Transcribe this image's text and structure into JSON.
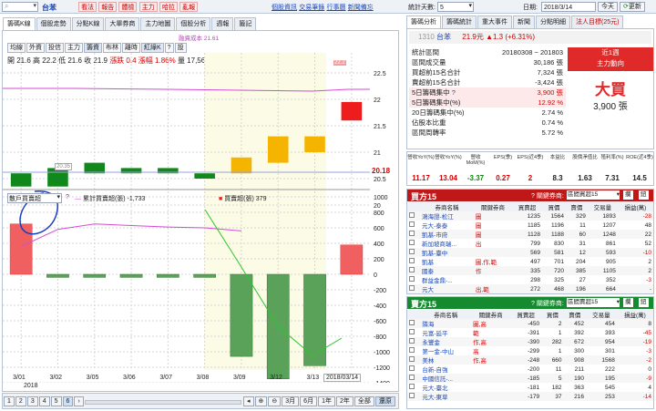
{
  "topbar": {
    "buttons": [
      "看法",
      "報告",
      "體檢",
      "主力",
      "哈拉",
      "亂報"
    ],
    "stock_name": "台苯",
    "links": [
      "個股資訊",
      "交易筆錄",
      "行事曆",
      "新聞備忘"
    ],
    "right_links": [
      "個股資訊",
      "交易筆錄",
      "行事曆",
      "到價通知"
    ],
    "days_label": "統計天數:",
    "days_value": "5",
    "date_label": "日期:",
    "date_value": "2018/3/14",
    "today_btn": "今天",
    "refresh_btn": "更新"
  },
  "left_tabs": [
    "籌碼K線",
    "個股走勢",
    "分點K線",
    "大單券商",
    "主力地圖",
    "個股分析",
    "週報",
    "籤記"
  ],
  "chips": [
    "均線",
    "外資",
    "投信",
    "主力",
    "籌資",
    "布林",
    "離時",
    "紅綠K",
    "設"
  ],
  "legend_top": "融資成本 21.61",
  "ohlc": {
    "open_l": "開",
    "open": "21.6",
    "high_l": "高",
    "high": "22.2",
    "low_l": "低",
    "low": "21.6",
    "close_l": "收",
    "close": "21.9",
    "chg_l": "漲跌",
    "chg": "0.4",
    "pct_l": "漲幅",
    "pct": "1.86%",
    "vol_l": "量",
    "vol": "17,560"
  },
  "price_axis": [
    "22.5",
    "22",
    "21.5",
    "21",
    "20.5",
    "20"
  ],
  "price_marker": "20.18",
  "box_label_high": "22.2",
  "box_label_low": "20.35",
  "lower_select": "散戶買賣超",
  "lower_legend1": "累計買賣超(張) -1,733",
  "lower_legend2": "買賣超(張) 379",
  "lower_axis": [
    "1000",
    "800",
    "600",
    "400",
    "200",
    "0",
    "-200",
    "-400",
    "-600",
    "-800",
    "-1000",
    "-1200",
    "-1400",
    "-1600"
  ],
  "x_labels": [
    "3/01",
    "3/02",
    "3/05",
    "3/06",
    "3/07",
    "3/08",
    "3/09",
    "3/12",
    "3/13"
  ],
  "x_year": "2018",
  "x_current": "2018/03/14",
  "bottom": {
    "pages": [
      "1",
      "2",
      "3",
      "4",
      "5",
      "6"
    ],
    "ranges": [
      "3月",
      "6月",
      "1年",
      "2年",
      "全部",
      "還原"
    ]
  },
  "chart_data": {
    "type": "candlestick",
    "categories": [
      "3/01",
      "3/02",
      "3/05",
      "3/06",
      "3/07",
      "3/08",
      "3/09",
      "3/12",
      "3/13",
      "3/14"
    ],
    "candles": [
      {
        "o": 20.6,
        "c": 20.35,
        "color": "green"
      },
      {
        "o": 20.7,
        "c": 20.35,
        "color": "green"
      },
      {
        "o": 20.8,
        "c": 20.6,
        "color": "green"
      },
      {
        "o": 20.7,
        "c": 20.6,
        "color": "green"
      },
      {
        "o": 20.7,
        "c": 20.6,
        "color": "green"
      },
      {
        "o": 20.5,
        "c": 20.6,
        "color": "green"
      },
      {
        "o": 20.6,
        "c": 20.9,
        "color": "orange"
      },
      {
        "o": 20.8,
        "c": 21.3,
        "color": "orange"
      },
      {
        "o": 21.3,
        "c": 21.0,
        "color": "orange"
      },
      {
        "o": 21.6,
        "c": 21.95,
        "color": "red"
      }
    ],
    "bars": [
      650,
      -40,
      -40,
      -40,
      -40,
      -40,
      -1060,
      -1350,
      -1180,
      379
    ],
    "cum": [
      360,
      580,
      650,
      630,
      610,
      600,
      560,
      -1280,
      -1420,
      -1733
    ]
  },
  "right_tabs": [
    "籌碼分析",
    "籌碼統計",
    "重大事件",
    "新聞",
    "分點明細",
    "法人目標(25元)"
  ],
  "quote": {
    "code": "1310",
    "name": "台苯",
    "price": "21.9元",
    "chg": "▲1.3 (+6.31%)"
  },
  "stats": [
    {
      "k": "統計區間",
      "v": "20180308 ~ 201803"
    },
    {
      "k": "區間成交量",
      "v": "30,186 張"
    },
    {
      "k": "買超前15名合計",
      "v": "7,324 張"
    },
    {
      "k": "賣超前15名合計",
      "v": "-3,424 張"
    },
    {
      "k": "5日籌碼集中",
      "v": "3,900 張"
    },
    {
      "k": "5日籌碼集中(%)",
      "v": "12.92 %"
    },
    {
      "k": "20日籌碼集中(%)",
      "v": "2.74 %"
    },
    {
      "k": "佔股本比重",
      "v": "0.74 %"
    },
    {
      "k": "區間周轉率",
      "v": "5.72 %"
    }
  ],
  "signal": {
    "title": "近1週",
    "sub": "主力動向",
    "big": "大買",
    "amt": "3,900 張"
  },
  "metrics_head": [
    "營收YoY(%)",
    "營收YoY(%)",
    "營收MoM(%)",
    "EPS(季)",
    "EPS(近4季)",
    "本益比",
    "股價淨值比",
    "殖利率(%)",
    "ROE(近4季)"
  ],
  "metrics_val": [
    "11.17",
    "13.04",
    "-3.37",
    "0.27",
    "2",
    "8.3",
    "1.63",
    "7.31",
    "14.5"
  ],
  "buy": {
    "title": "買方15",
    "hint": "關鍵券商:",
    "select": "區間買超15",
    "btn1": "攔",
    "btn2": "鈕",
    "head": [
      "券商名稱",
      "關鍵券商",
      "買賣超",
      "買價",
      "賣價",
      "交易量",
      "損益(萬)"
    ],
    "rows": [
      [
        "鴻海證-松江",
        "圖",
        "1235",
        "1564",
        "329",
        "1893",
        "-28"
      ],
      [
        "元大-泰泰",
        "圖",
        "1185",
        "1196",
        "11",
        "1207",
        "48"
      ],
      [
        "凱基-市府",
        "圖",
        "1128",
        "1188",
        "60",
        "1248",
        "22"
      ],
      [
        "新加坡商瑞...",
        "出",
        "799",
        "830",
        "31",
        "861",
        "52"
      ],
      [
        "凱基-臺中",
        "",
        "569",
        "581",
        "12",
        "593",
        "-10"
      ],
      [
        "凱基",
        "圖,作,範",
        "497",
        "701",
        "204",
        "905",
        "2"
      ],
      [
        "國泰",
        "作",
        "335",
        "720",
        "385",
        "1105",
        "2"
      ],
      [
        "群益金鼎-...",
        "",
        "298",
        "325",
        "27",
        "352",
        "-3"
      ],
      [
        "元大",
        "出,範",
        "272",
        "468",
        "196",
        "664",
        "-"
      ]
    ]
  },
  "sell": {
    "title": "賣方15",
    "hint": "關鍵券商:",
    "select": "區間賣超15",
    "btn1": "攔",
    "btn2": "鈕",
    "head": [
      "券商名稱",
      "關鍵券商",
      "買賣超",
      "買價",
      "賣價",
      "交易量",
      "損益(萬)"
    ],
    "rows": [
      [
        "隣海",
        "圖,高",
        "-450",
        "2",
        "452",
        "454",
        "8"
      ],
      [
        "元富-延平",
        "範",
        "-391",
        "1",
        "392",
        "393",
        "-45"
      ],
      [
        "永豐金",
        "作,高",
        "-390",
        "282",
        "672",
        "954",
        "-19"
      ],
      [
        "第一金-中山",
        "高",
        "-299",
        "1",
        "300",
        "301",
        "-3"
      ],
      [
        "美林",
        "作,高",
        "-248",
        "660",
        "908",
        "1568",
        "-2"
      ],
      [
        "台新-自強",
        "",
        "-200",
        "11",
        "211",
        "222",
        "0"
      ],
      [
        "中國信託-...",
        "",
        "-185",
        "5",
        "190",
        "195",
        "-9"
      ],
      [
        "元大-臺北",
        "",
        "-181",
        "182",
        "363",
        "545",
        "4"
      ],
      [
        "元大-東草",
        "",
        "-179",
        "37",
        "216",
        "253",
        "-14"
      ]
    ]
  }
}
